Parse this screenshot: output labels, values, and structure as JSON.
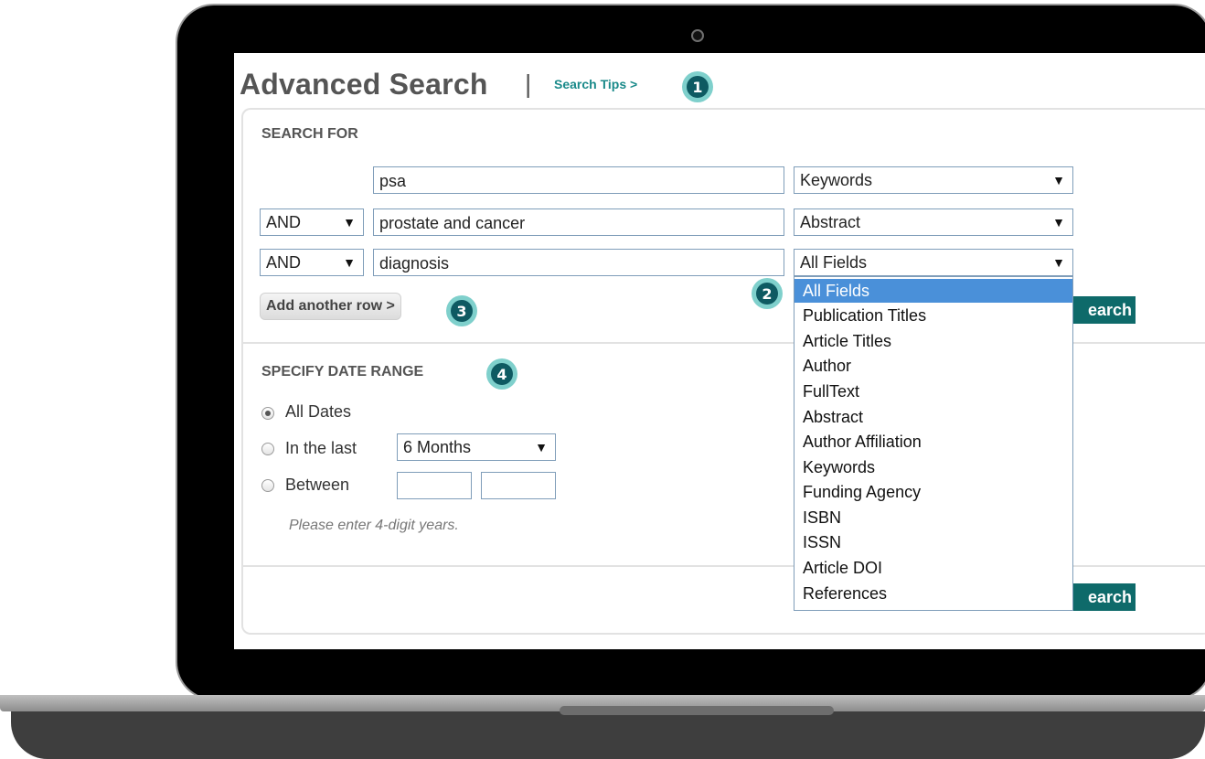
{
  "header": {
    "title": "Advanced Search",
    "separator": "|",
    "search_tips": "Search Tips >"
  },
  "badges": [
    "1",
    "2",
    "3",
    "4"
  ],
  "search_for": {
    "label": "SEARCH FOR",
    "rows": [
      {
        "operator": "",
        "term": "psa",
        "field": "Keywords"
      },
      {
        "operator": "AND",
        "term": "prostate and cancer",
        "field": "Abstract"
      },
      {
        "operator": "AND",
        "term": "diagnosis",
        "field": "All Fields"
      }
    ],
    "add_row": "Add another row >",
    "search_button": "earch"
  },
  "field_dropdown": {
    "selected": "All Fields",
    "options": [
      "All Fields",
      "Publication Titles",
      "Article Titles",
      "Author",
      "FullText",
      "Abstract",
      "Author Affiliation",
      "Keywords",
      "Funding Agency",
      "ISBN",
      "ISSN",
      "Article DOI",
      "References"
    ]
  },
  "date_range": {
    "label": "SPECIFY DATE RANGE",
    "options": [
      "All Dates",
      "In the last",
      "Between"
    ],
    "selected_option": "All Dates",
    "in_the_last_value": "6 Months",
    "between_from": "",
    "between_to": "",
    "hint": "Please enter 4-digit years."
  },
  "bottom_search_button": "earch",
  "colors": {
    "accent": "#0e6a6a",
    "badge_ring": "#7fd0cc",
    "badge_fill": "#0e5a62",
    "selection": "#4a90d9",
    "link": "#1a8a8a"
  }
}
